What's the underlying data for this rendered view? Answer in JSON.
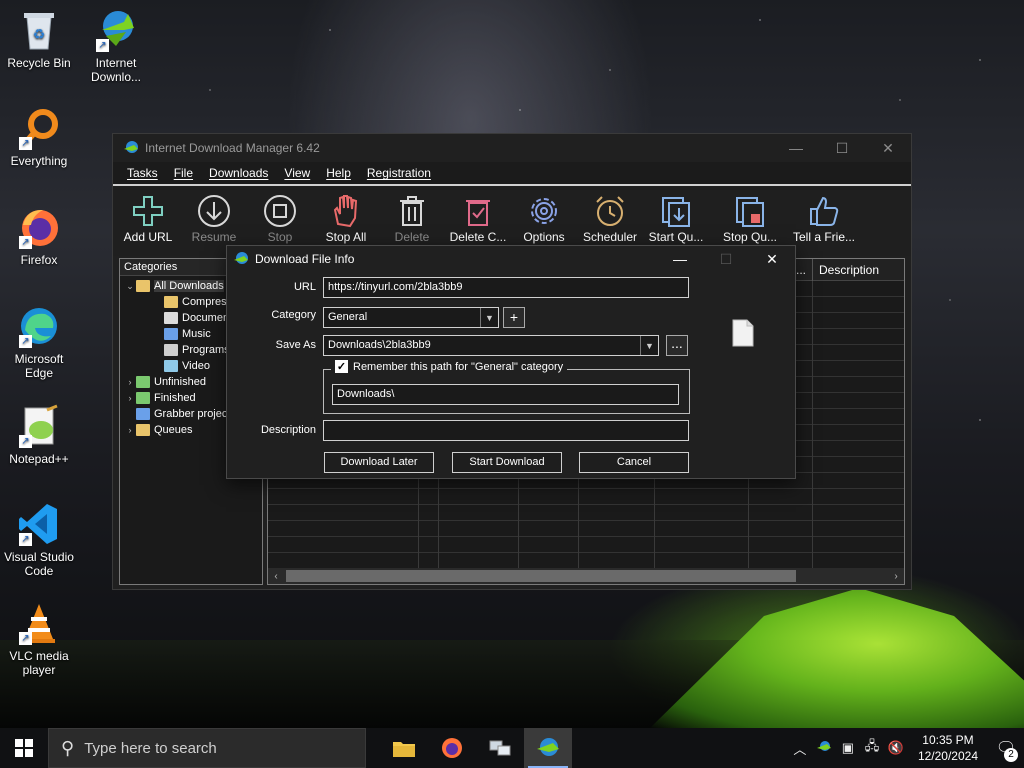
{
  "desktop": {
    "icons": [
      {
        "label": "Recycle Bin"
      },
      {
        "label": "Internet Downlo..."
      },
      {
        "label": "Everything"
      },
      {
        "label": "Firefox"
      },
      {
        "label": "Microsoft Edge"
      },
      {
        "label": "Notepad++"
      },
      {
        "label": "Visual Studio Code"
      },
      {
        "label": "VLC media player"
      }
    ]
  },
  "idm": {
    "title": "Internet Download Manager 6.42",
    "menu": [
      "Tasks",
      "File",
      "Downloads",
      "View",
      "Help",
      "Registration"
    ],
    "toolbar": [
      {
        "label": "Add URL",
        "icon": "plus-icon",
        "enabled": true
      },
      {
        "label": "Resume",
        "icon": "resume-icon",
        "enabled": false
      },
      {
        "label": "Stop",
        "icon": "stop-icon",
        "enabled": false
      },
      {
        "label": "Stop All",
        "icon": "hand-icon",
        "enabled": true
      },
      {
        "label": "Delete",
        "icon": "trash-icon",
        "enabled": false
      },
      {
        "label": "Delete C...",
        "icon": "delete-completed-icon",
        "enabled": true
      },
      {
        "label": "Options",
        "icon": "gear-icon",
        "enabled": true
      },
      {
        "label": "Scheduler",
        "icon": "alarm-clock-icon",
        "enabled": true
      },
      {
        "label": "Start Qu...",
        "icon": "start-queue-icon",
        "enabled": true
      },
      {
        "label": "Stop Qu...",
        "icon": "stop-queue-icon",
        "enabled": true
      },
      {
        "label": "Tell a Frie...",
        "icon": "thumbs-up-icon",
        "enabled": true
      }
    ],
    "categories": {
      "header": "Categories",
      "items": [
        {
          "label": "All Downloads",
          "level": 0,
          "expand": "⌄",
          "color": "#e9c46a",
          "selected": true
        },
        {
          "label": "Compressed",
          "level": 1,
          "expand": "",
          "color": "#e9c46a"
        },
        {
          "label": "Documents",
          "level": 1,
          "expand": "",
          "color": "#dcdcdc"
        },
        {
          "label": "Music",
          "level": 1,
          "expand": "",
          "color": "#6aa0e9"
        },
        {
          "label": "Programs",
          "level": 1,
          "expand": "",
          "color": "#cfcfcf"
        },
        {
          "label": "Video",
          "level": 1,
          "expand": "",
          "color": "#8fc9e8"
        },
        {
          "label": "Unfinished",
          "level": 0,
          "expand": "›",
          "color": "#7bc96f"
        },
        {
          "label": "Finished",
          "level": 0,
          "expand": "›",
          "color": "#7bc96f"
        },
        {
          "label": "Grabber projects",
          "level": 0,
          "expand": "",
          "color": "#6aa0e9"
        },
        {
          "label": "Queues",
          "level": 0,
          "expand": "›",
          "color": "#e9c46a"
        }
      ]
    },
    "list": {
      "col_desc": "Description",
      "col_more": "..."
    }
  },
  "dialog": {
    "title": "Download File Info",
    "url_label": "URL",
    "url_value": "https://tinyurl.com/2bla3bb9",
    "category_label": "Category",
    "category_value": "General",
    "saveas_label": "Save As",
    "saveas_value": "Downloads\\2bla3bb9",
    "browse_label": "...",
    "add_label": "+",
    "remember_label": "Remember this path for \"General\" category",
    "remember_checked": true,
    "remember_path": "Downloads\\",
    "description_label": "Description",
    "description_value": "",
    "btn_later": "Download Later",
    "btn_start": "Start Download",
    "btn_cancel": "Cancel"
  },
  "taskbar": {
    "search_placeholder": "Type here to search",
    "time": "10:35 PM",
    "date": "12/20/2024",
    "notifications": "2"
  }
}
